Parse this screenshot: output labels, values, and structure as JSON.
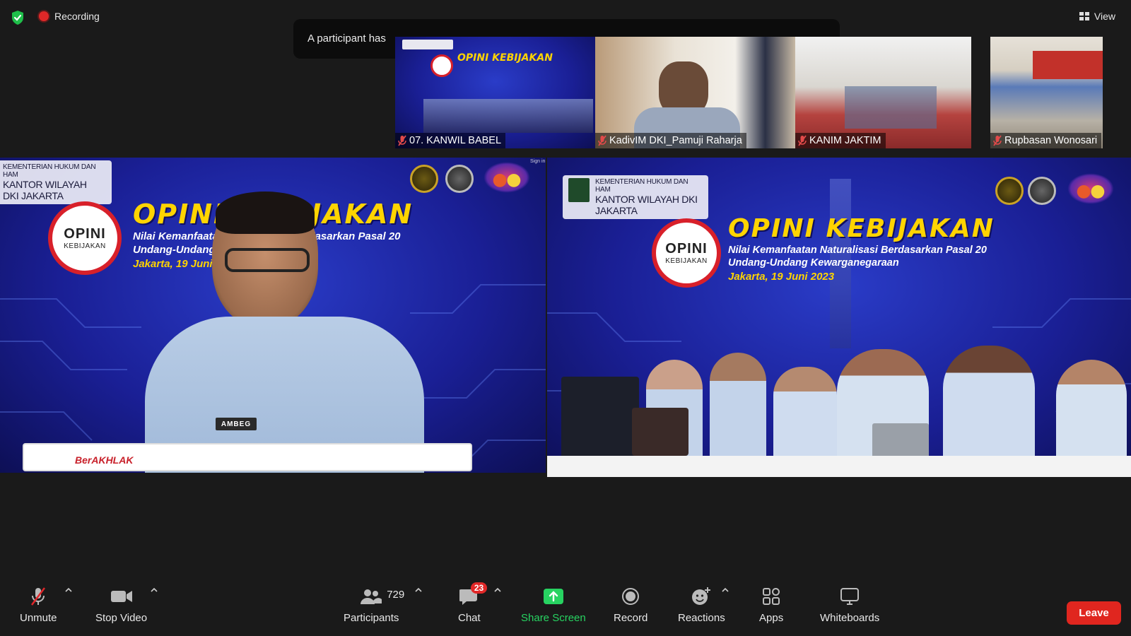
{
  "topbar": {
    "recording_label": "Recording",
    "view_label": "View"
  },
  "toast": {
    "text": "A participant has"
  },
  "thumbnails": [
    {
      "name": "07. KANWIL BABEL",
      "muted": true
    },
    {
      "name": "KadivIM DKI_Pamuji Raharja",
      "muted": true
    },
    {
      "name": "KANIM JAKTIM",
      "muted": true
    },
    {
      "name": "Rupbasan Wonosari",
      "muted": true
    }
  ],
  "main_left": {
    "badge_line1": "KEMENTERIAN HUKUM DAN HAM",
    "badge_line2": "KANTOR WILAYAH DKI JAKARTA",
    "title": "OPINI KEBIJAKAN",
    "subtitle_line1": "Nilai Kemanfaatan Naturalisasi Berdasarkan Pasal 20",
    "subtitle_line2": "Undang-Undang Kewarganegaraan",
    "date": "Jakarta, 19 Juni 2023",
    "logo_line1": "OPINI",
    "logo_line2": "KEBIJAKAN",
    "nametag": "AMBEG",
    "banner": "BerAKHLAK",
    "sign_in": "Sign in"
  },
  "main_right": {
    "badge_line1": "KEMENTERIAN HUKUM DAN HAM",
    "badge_line2": "KANTOR WILAYAH DKI JAKARTA",
    "title": "OPINI KEBIJAKAN",
    "subtitle_line1": "Nilai Kemanfaatan Naturalisasi Berdasarkan Pasal 20",
    "subtitle_line2": "Undang-Undang Kewarganegaraan",
    "date": "Jakarta, 19 Juni 2023",
    "logo_line1": "OPINI",
    "logo_line2": "KEBIJAKAN"
  },
  "toolbar": {
    "unmute": "Unmute",
    "stop_video": "Stop Video",
    "participants": "Participants",
    "participants_count": "729",
    "chat": "Chat",
    "chat_badge": "23",
    "share_screen": "Share Screen",
    "record": "Record",
    "reactions": "Reactions",
    "apps": "Apps",
    "whiteboards": "Whiteboards",
    "leave": "Leave"
  },
  "colors": {
    "background": "#1a1a1a",
    "leave": "#e0261f",
    "share_green": "#27d361",
    "title_yellow": "#ffd400",
    "recording_red": "#e02828"
  }
}
